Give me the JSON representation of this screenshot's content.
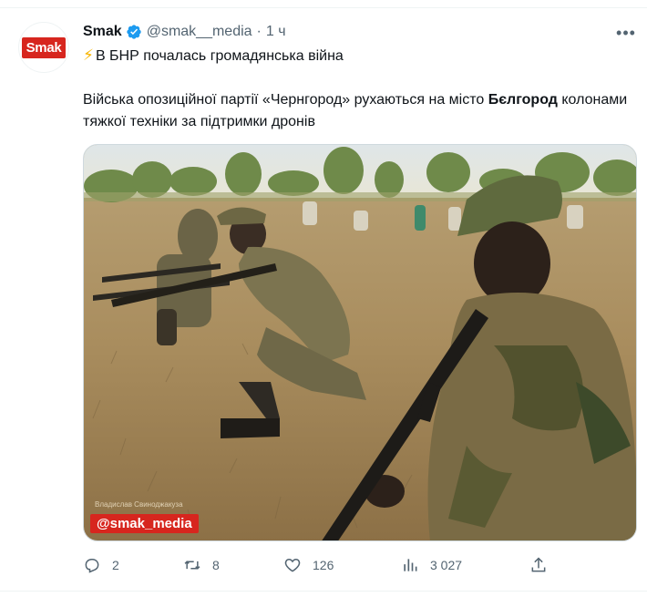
{
  "author": {
    "name": "Smak",
    "handle": "@smak__media",
    "separator": "·",
    "time": "1 ч",
    "avatar_text": "Smak"
  },
  "tweet": {
    "line1_icon": "⚡",
    "line1": "В БНР почалась громадянська війна",
    "para_part1": "Війська опозиційної партії «Чернгород» рухаються на місто ",
    "para_bold": "Бєлгород",
    "para_part2": " колонами тяжкої техніки за підтримки дронів"
  },
  "media": {
    "watermark": "@smak_media",
    "credit": "Владислав Свиноджакуза"
  },
  "actions": {
    "replies": "2",
    "reposts": "8",
    "likes": "126",
    "views": "3 027"
  },
  "colors": {
    "verified": "#1d9bf0",
    "brand": "#d7261e",
    "muted": "#536471"
  },
  "icons": [
    "more-icon",
    "verified-icon",
    "reply-icon",
    "repost-icon",
    "like-icon",
    "views-icon",
    "share-icon"
  ]
}
